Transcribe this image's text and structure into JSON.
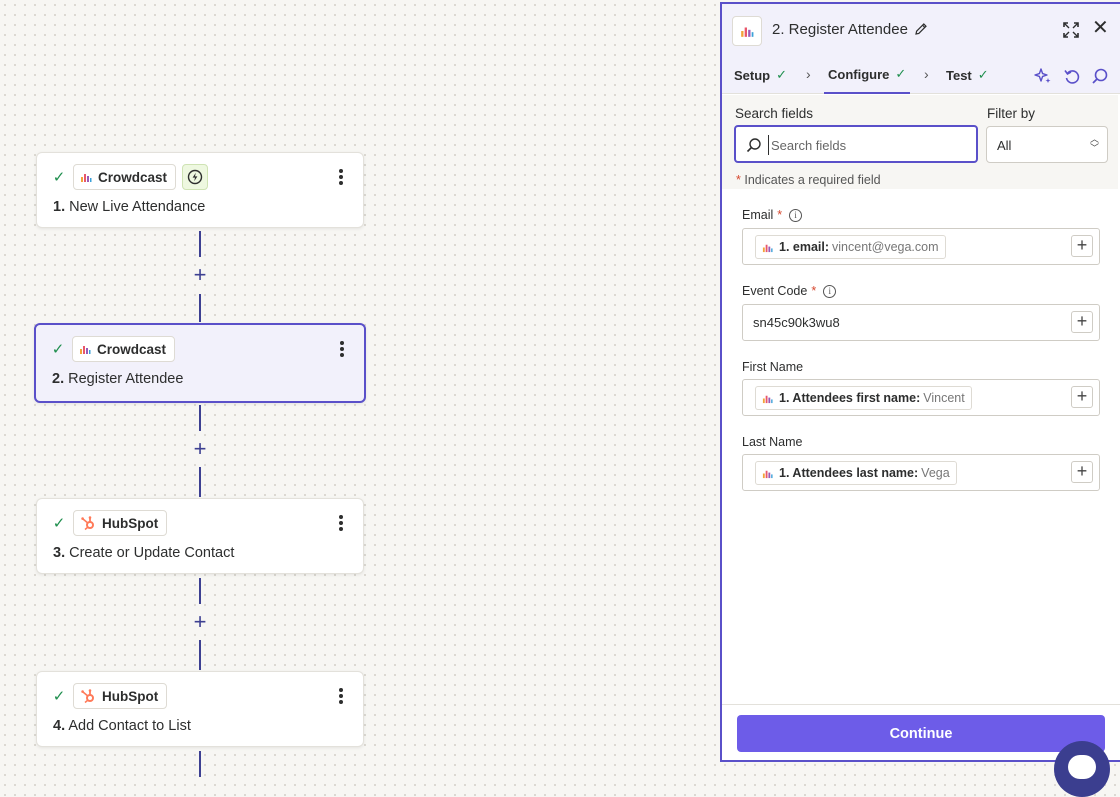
{
  "canvas": {
    "steps": [
      {
        "number": "1.",
        "title": "New Live Attendance",
        "app": "Crowdcast",
        "app_icon": "crowdcast-logo",
        "status": "complete",
        "trigger": true
      },
      {
        "number": "2.",
        "title": "Register Attendee",
        "app": "Crowdcast",
        "app_icon": "crowdcast-logo",
        "status": "complete",
        "selected": true
      },
      {
        "number": "3.",
        "title": "Create or Update Contact",
        "app": "HubSpot",
        "app_icon": "hubspot-logo",
        "status": "complete"
      },
      {
        "number": "4.",
        "title": "Add Contact to List",
        "app": "HubSpot",
        "app_icon": "hubspot-logo",
        "status": "complete"
      }
    ],
    "add_step_glyph": "+"
  },
  "panel": {
    "title": "2. Register Attendee",
    "close_glyph": "✕",
    "tabs": [
      {
        "label": "Setup",
        "complete": true
      },
      {
        "label": "Configure",
        "complete": true,
        "active": true
      },
      {
        "label": "Test",
        "complete": true
      }
    ],
    "tab_separator": "›",
    "search": {
      "label": "Search fields",
      "placeholder": "Search fields",
      "value": ""
    },
    "filter": {
      "label": "Filter by",
      "value": "All"
    },
    "required_note": "Indicates a required field",
    "required_star": "*",
    "fields": [
      {
        "label": "Email",
        "required": true,
        "info": true,
        "mapped": true,
        "pill_label": "1. email:",
        "pill_value": "vincent@vega.com"
      },
      {
        "label": "Event Code",
        "required": true,
        "info": true,
        "mapped": false,
        "value": "sn45c90k3wu8"
      },
      {
        "label": "First Name",
        "required": false,
        "mapped": true,
        "pill_label": "1. Attendees first name:",
        "pill_value": "Vincent"
      },
      {
        "label": "Last Name",
        "required": false,
        "mapped": true,
        "pill_label": "1. Attendees last name:",
        "pill_value": "Vega"
      }
    ],
    "continue_label": "Continue"
  },
  "colors": {
    "accent": "#5a50c9",
    "button": "#6d5ce8",
    "success": "#1f8f4e",
    "required": "#d6472e",
    "hubspot": "#ff7a59"
  },
  "icons": [
    "check-icon",
    "lightning-icon",
    "kebab-icon",
    "pencil-icon",
    "expand-icon",
    "close-icon",
    "sparkle-icon",
    "undo-icon",
    "search-icon",
    "info-icon",
    "plus-icon",
    "help-chat-icon"
  ]
}
